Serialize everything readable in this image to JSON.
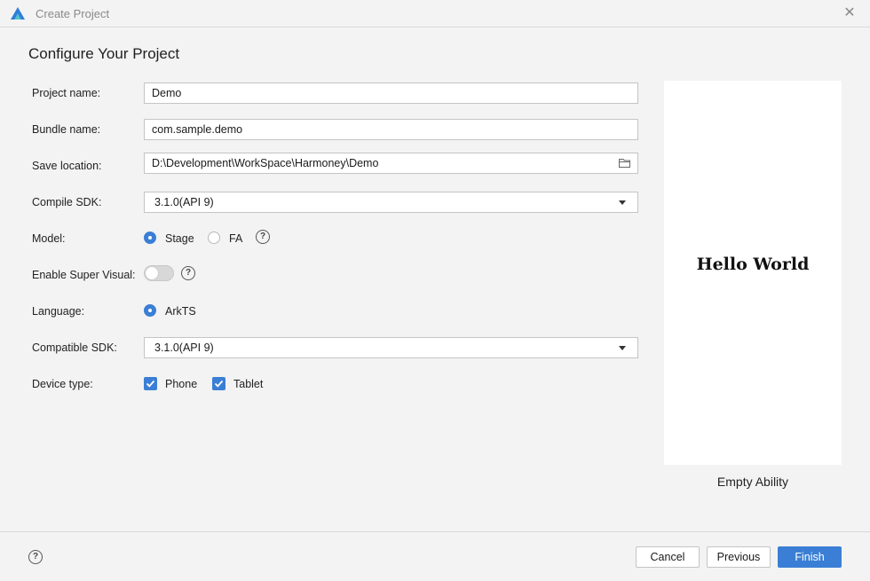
{
  "window": {
    "title": "Create Project",
    "close_glyph": "✕",
    "logo_icon": "deveco-logo-icon"
  },
  "page": {
    "heading": "Configure Your Project"
  },
  "form": {
    "project_name": {
      "label": "Project name:",
      "value": "Demo"
    },
    "bundle_name": {
      "label": "Bundle name:",
      "value": "com.sample.demo"
    },
    "save_location": {
      "label": "Save location:",
      "value": "D:\\Development\\WorkSpace\\Harmoney\\Demo",
      "icon": "folder-icon"
    },
    "compile_sdk": {
      "label": "Compile SDK:",
      "value": "3.1.0(API 9)"
    },
    "model": {
      "label": "Model:",
      "options": [
        {
          "label": "Stage",
          "selected": true
        },
        {
          "label": "FA",
          "selected": false
        }
      ],
      "help": "?"
    },
    "super_visual": {
      "label": "Enable Super Visual:",
      "enabled": false,
      "help": "?"
    },
    "language": {
      "label": "Language:",
      "options": [
        {
          "label": "ArkTS",
          "selected": true
        }
      ]
    },
    "compatible_sdk": {
      "label": "Compatible SDK:",
      "value": "3.1.0(API 9)"
    },
    "device_type": {
      "label": "Device type:",
      "options": [
        {
          "label": "Phone",
          "checked": true
        },
        {
          "label": "Tablet",
          "checked": true
        }
      ]
    }
  },
  "preview": {
    "text": "Hello World",
    "template_name": "Empty Ability"
  },
  "footer": {
    "help": "?",
    "cancel_label": "Cancel",
    "previous_label": "Previous",
    "finish_label": "Finish"
  },
  "colors": {
    "accent": "#3a7fd5",
    "background": "#f3f3f3"
  }
}
